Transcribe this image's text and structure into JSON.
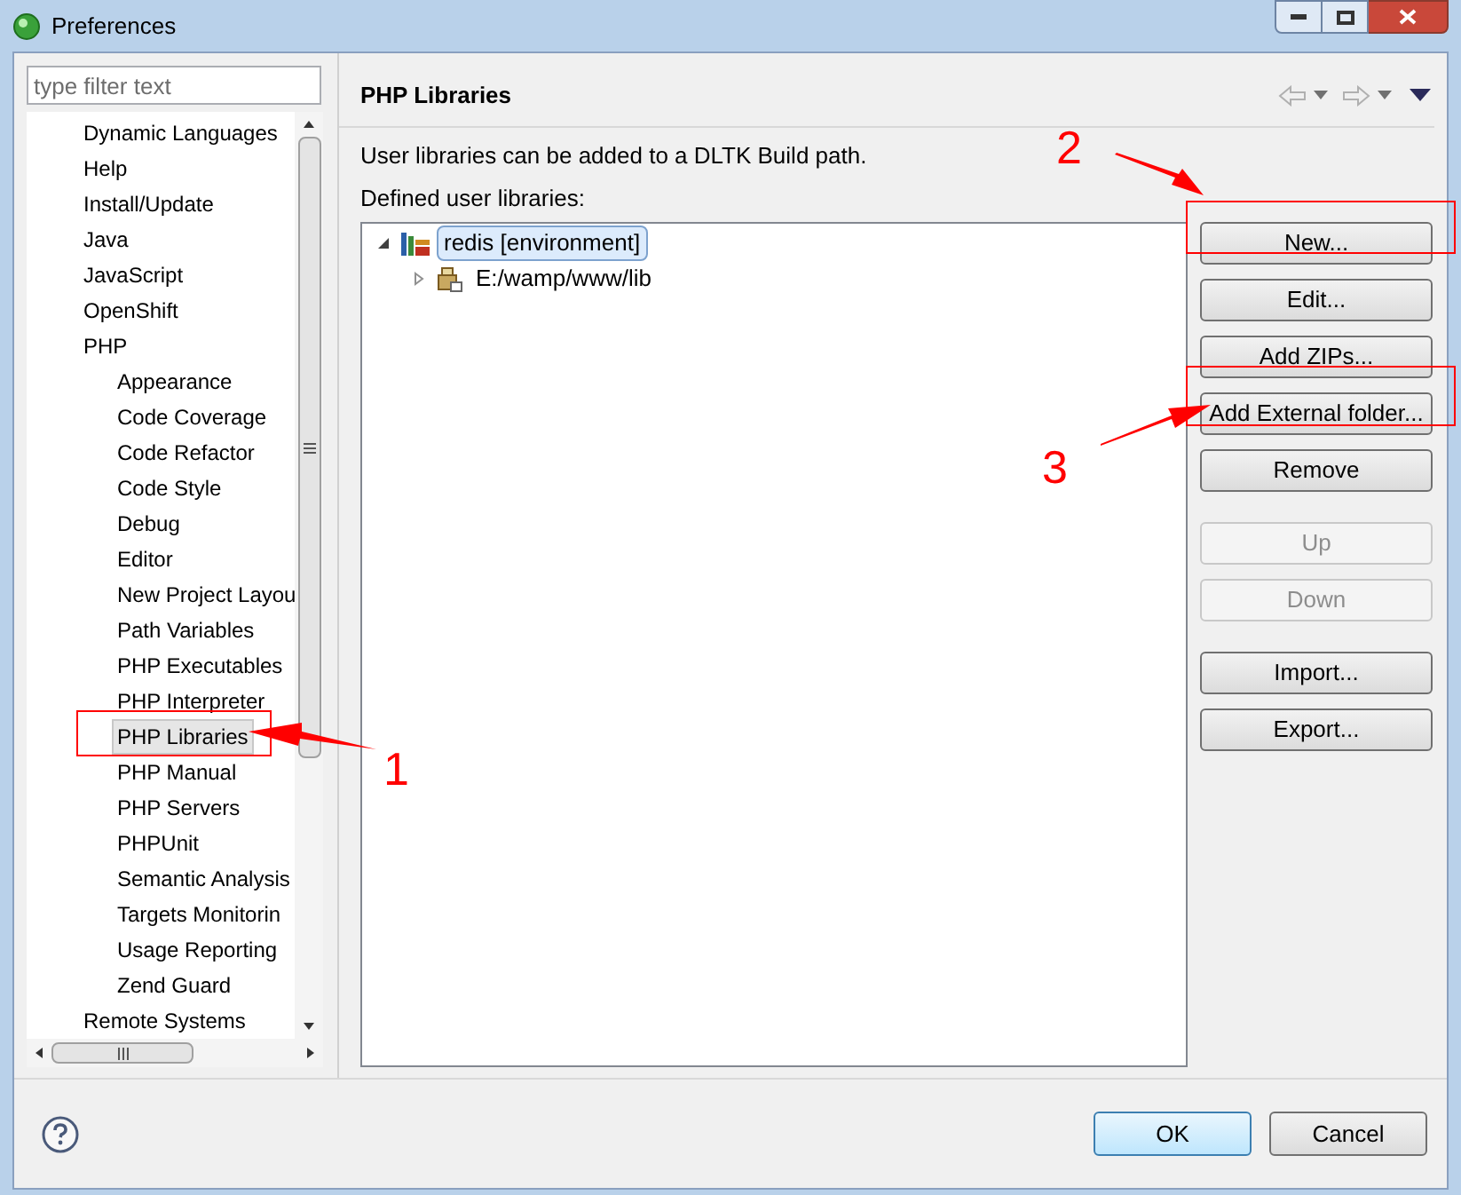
{
  "window": {
    "title": "Preferences"
  },
  "filter": {
    "placeholder": "type filter text"
  },
  "nav_tree": [
    {
      "label": "Dynamic Languages",
      "selected": false
    },
    {
      "label": "Help",
      "selected": false
    },
    {
      "label": "Install/Update",
      "selected": false
    },
    {
      "label": "Java",
      "selected": false
    },
    {
      "label": "JavaScript",
      "selected": false
    },
    {
      "label": "OpenShift",
      "selected": false
    },
    {
      "label": "PHP",
      "selected": false,
      "children": [
        {
          "label": "Appearance",
          "selected": false
        },
        {
          "label": "Code Coverage",
          "selected": false
        },
        {
          "label": "Code Refactor",
          "selected": false
        },
        {
          "label": "Code Style",
          "selected": false
        },
        {
          "label": "Debug",
          "selected": false
        },
        {
          "label": "Editor",
          "selected": false
        },
        {
          "label": "New Project Layou",
          "selected": false
        },
        {
          "label": "Path Variables",
          "selected": false
        },
        {
          "label": "PHP Executables",
          "selected": false
        },
        {
          "label": "PHP Interpreter",
          "selected": false
        },
        {
          "label": "PHP Libraries",
          "selected": true
        },
        {
          "label": "PHP Manual",
          "selected": false
        },
        {
          "label": "PHP Servers",
          "selected": false
        },
        {
          "label": "PHPUnit",
          "selected": false
        },
        {
          "label": "Semantic Analysis",
          "selected": false
        },
        {
          "label": "Targets Monitorin",
          "selected": false
        },
        {
          "label": "Usage Reporting",
          "selected": false
        },
        {
          "label": "Zend Guard",
          "selected": false
        }
      ]
    },
    {
      "label": "Remote Systems",
      "selected": false
    }
  ],
  "page": {
    "title": "PHP Libraries",
    "description": "User libraries can be added to a DLTK Build path.",
    "list_label": "Defined user libraries:"
  },
  "libraries": [
    {
      "label": "redis [environment]",
      "selected": true,
      "expanded": true,
      "children": [
        {
          "label": "E:/wamp/www/lib",
          "selected": false,
          "expanded": false
        }
      ]
    }
  ],
  "button_groups": [
    [
      {
        "label": "New...",
        "disabled": false
      },
      {
        "label": "Edit...",
        "disabled": false
      },
      {
        "label": "Add ZIPs...",
        "disabled": false
      },
      {
        "label": "Add External folder...",
        "disabled": false
      },
      {
        "label": "Remove",
        "disabled": false
      }
    ],
    [
      {
        "label": "Up",
        "disabled": true
      },
      {
        "label": "Down",
        "disabled": true
      }
    ],
    [
      {
        "label": "Import...",
        "disabled": false
      },
      {
        "label": "Export...",
        "disabled": false
      }
    ]
  ],
  "footer_buttons": [
    {
      "label": "OK",
      "default": true
    },
    {
      "label": "Cancel",
      "default": false
    }
  ],
  "annotations": [
    {
      "label": "1"
    },
    {
      "label": "2"
    },
    {
      "label": "3"
    }
  ]
}
